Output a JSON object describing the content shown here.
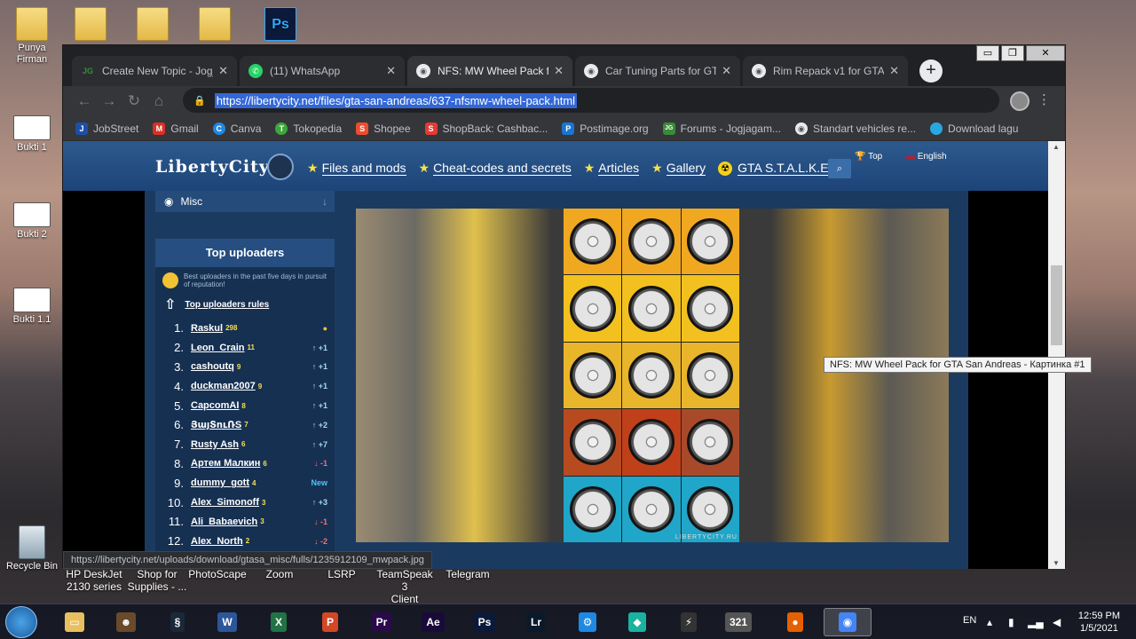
{
  "desktop": {
    "icons": [
      {
        "label": "Punya\nFirman",
        "kind": "folder"
      },
      {
        "label": "",
        "kind": "folder"
      },
      {
        "label": "",
        "kind": "folder"
      },
      {
        "label": "",
        "kind": "folder"
      },
      {
        "label": "",
        "kind": "psd",
        "glyph": "Ps",
        "badge": "PSD"
      },
      {
        "label": "Bukti 1",
        "kind": "shot"
      },
      {
        "label": "Bukti 2",
        "kind": "shot"
      },
      {
        "label": "Bukti 1.1",
        "kind": "shot"
      },
      {
        "label": "Recycle Bin",
        "kind": "bin"
      }
    ],
    "bottom_labels": [
      "HP DeskJet\n2130 series",
      "Shop for\nSupplies - ...",
      "PhotoScape",
      "Zoom",
      "LSRP",
      "TeamSpeak 3\nClient",
      "Telegram"
    ]
  },
  "browser": {
    "tabs": [
      {
        "title": "Create New Topic - Jogjag",
        "favicon": "JG",
        "color": "#3a8a3a",
        "active": false
      },
      {
        "title": "(11) WhatsApp",
        "favicon": "W",
        "color": "#25d366",
        "active": false
      },
      {
        "title": "NFS: MW Wheel Pack for GTA",
        "favicon": "",
        "color": "#e8eaed",
        "active": true
      },
      {
        "title": "Car Tuning Parts for GTA San",
        "favicon": "",
        "color": "#e8eaed",
        "active": false
      },
      {
        "title": "Rim Repack v1 for GTA San",
        "favicon": "",
        "color": "#e8eaed",
        "active": false
      }
    ],
    "url": "https://libertycity.net/files/gta-san-andreas/637-nfsmw-wheel-pack.html",
    "bookmarks": [
      {
        "label": "JobStreet",
        "icon": "J",
        "color": "#1d4fa8"
      },
      {
        "label": "Gmail",
        "icon": "M",
        "color": "#d93025"
      },
      {
        "label": "Canva",
        "icon": "C",
        "color": "#1e88e5"
      },
      {
        "label": "Tokopedia",
        "icon": "T",
        "color": "#3ca83c"
      },
      {
        "label": "Shopee",
        "icon": "S",
        "color": "#ee4d2d"
      },
      {
        "label": "ShopBack: Cashbac...",
        "icon": "S",
        "color": "#e53935"
      },
      {
        "label": "Postimage.org",
        "icon": "P",
        "color": "#1976d2"
      },
      {
        "label": "Forums - Jogjagam...",
        "icon": "JG",
        "color": "#3a8a3a"
      },
      {
        "label": "Standart vehicles re...",
        "icon": "",
        "color": "#e8eaed"
      },
      {
        "label": "Download lagu",
        "icon": "",
        "color": "#29a8e0"
      }
    ],
    "status_url": "https://libertycity.net/uploads/download/gtasa_misc/fulls/1235912109_mwpack.jpg",
    "tooltip": "NFS: MW Wheel Pack for GTA San Andreas - Картинка #1"
  },
  "site": {
    "logo": "LibertyCity",
    "menu": [
      "Files and mods",
      "Cheat-codes and secrets",
      "Articles",
      "Gallery",
      "GTA S.T.A.L.K.E.R."
    ],
    "top_label": "Top",
    "lang_label": "English",
    "misc_label": "Misc",
    "uploaders_title": "Top uploaders",
    "uploaders_desc": "Best uploaders in the past five days in pursuit of reputation!",
    "uploaders_rules": "Top uploaders rules",
    "uploaders": [
      {
        "rank": "1.",
        "name": "Raskul",
        "score": "298",
        "trend": "",
        "dir": "ico"
      },
      {
        "rank": "2.",
        "name": "Leon_Crain",
        "score": "11",
        "trend": "+1",
        "dir": "up"
      },
      {
        "rank": "3.",
        "name": "cashoutq",
        "score": "9",
        "trend": "+1",
        "dir": "up"
      },
      {
        "rank": "4.",
        "name": "duckman2007",
        "score": "9",
        "trend": "+1",
        "dir": "up"
      },
      {
        "rank": "5.",
        "name": "CapcomAI",
        "score": "8",
        "trend": "+1",
        "dir": "up"
      },
      {
        "rank": "6.",
        "name": "ՅայՏուՌS",
        "score": "7",
        "trend": "+2",
        "dir": "up"
      },
      {
        "rank": "7.",
        "name": "Rusty Ash",
        "score": "6",
        "trend": "+7",
        "dir": "up"
      },
      {
        "rank": "8.",
        "name": "Артем Малкин",
        "score": "6",
        "trend": "-1",
        "dir": "down"
      },
      {
        "rank": "9.",
        "name": "dummy_gott",
        "score": "4",
        "trend": "New",
        "dir": "new"
      },
      {
        "rank": "10.",
        "name": "Alex_Simonoff",
        "score": "3",
        "trend": "+3",
        "dir": "up"
      },
      {
        "rank": "11.",
        "name": "Ali_Babaevich",
        "score": "3",
        "trend": "-1",
        "dir": "down"
      },
      {
        "rank": "12.",
        "name": "Alex_North",
        "score": "2",
        "trend": "-2",
        "dir": "down"
      }
    ],
    "watermark": "LIBERTYCITY.RU"
  },
  "taskbar": {
    "apps": [
      {
        "label": "Explorer",
        "glyph": "▭",
        "color": "#e8c060"
      },
      {
        "label": "GTA",
        "glyph": "☻",
        "color": "#6a4a2a"
      },
      {
        "label": "Steam",
        "glyph": "§",
        "color": "#1b2838"
      },
      {
        "label": "Word",
        "glyph": "W",
        "color": "#2b579a"
      },
      {
        "label": "Excel",
        "glyph": "X",
        "color": "#217346"
      },
      {
        "label": "PowerPoint",
        "glyph": "P",
        "color": "#d24726"
      },
      {
        "label": "Premiere",
        "glyph": "Pr",
        "color": "#2a0a4a"
      },
      {
        "label": "After Effects",
        "glyph": "Ae",
        "color": "#1a0a3a"
      },
      {
        "label": "Photoshop",
        "glyph": "Ps",
        "color": "#0b1a3a"
      },
      {
        "label": "Lightroom",
        "glyph": "Lr",
        "color": "#0a1a2a"
      },
      {
        "label": "App",
        "glyph": "⚙",
        "color": "#1e88e5"
      },
      {
        "label": "Filmora",
        "glyph": "◆",
        "color": "#1ab3a0"
      },
      {
        "label": "Tool",
        "glyph": "⚡",
        "color": "#333"
      },
      {
        "label": "Video",
        "glyph": "321",
        "color": "#555"
      },
      {
        "label": "Firefox",
        "glyph": "●",
        "color": "#e66000"
      },
      {
        "label": "Chrome",
        "glyph": "◉",
        "color": "#4285f4"
      }
    ],
    "lang": "EN",
    "time": "12:59 PM",
    "date": "1/5/2021"
  }
}
